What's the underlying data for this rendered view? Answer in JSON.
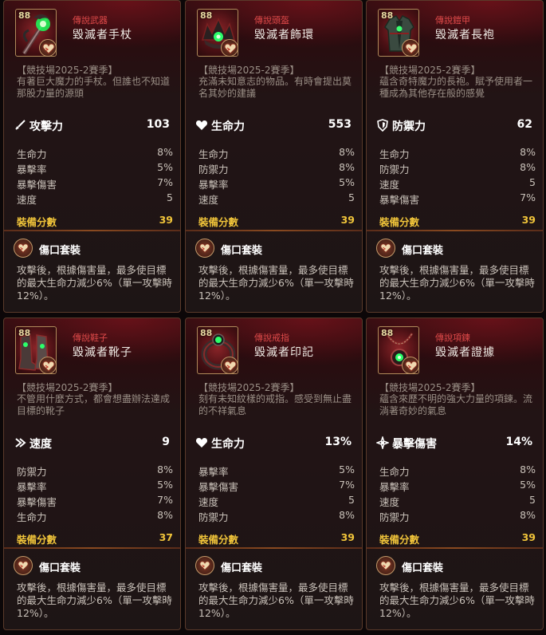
{
  "cards": [
    {
      "level": "88",
      "rarity": "傳說武器",
      "name": "毀滅者手杖",
      "season": "【競技場2025-2賽季】",
      "description": "有著巨大魔力的手杖。但誰也不知道那股力量的源頭",
      "main_stat": {
        "icon": "sword-icon",
        "label": "攻擊力",
        "value": "103"
      },
      "sub_stats": [
        {
          "label": "生命力",
          "value": "8%"
        },
        {
          "label": "暴擊率",
          "value": "5%"
        },
        {
          "label": "暴擊傷害",
          "value": "7%"
        },
        {
          "label": "速度",
          "value": "5"
        }
      ],
      "score_label": "裝備分數",
      "score": "39",
      "set_name": "傷口套裝",
      "set_desc": "攻擊後，根據傷害量，最多使目標的最大生命力減少6%（單一攻擊時12%）。"
    },
    {
      "level": "88",
      "rarity": "傳說頭盔",
      "name": "毀滅者飾環",
      "season": "【競技場2025-2賽季】",
      "description": "充滿未知意志的物品。有時會提出莫名其妙的建議",
      "main_stat": {
        "icon": "heart-icon",
        "label": "生命力",
        "value": "553"
      },
      "sub_stats": [
        {
          "label": "生命力",
          "value": "8%"
        },
        {
          "label": "防禦力",
          "value": "8%"
        },
        {
          "label": "暴擊率",
          "value": "5%"
        },
        {
          "label": "速度",
          "value": "5"
        }
      ],
      "score_label": "裝備分數",
      "score": "39",
      "set_name": "傷口套裝",
      "set_desc": "攻擊後，根據傷害量，最多使目標的最大生命力減少6%（單一攻擊時12%）。"
    },
    {
      "level": "88",
      "rarity": "傳說鎧甲",
      "name": "毀滅者長袍",
      "season": "【競技場2025-2賽季】",
      "description": "蘊含奇特魔力的長袍。賦予使用者一種成為其他存在般的感覺",
      "main_stat": {
        "icon": "shield-icon",
        "label": "防禦力",
        "value": "62"
      },
      "sub_stats": [
        {
          "label": "生命力",
          "value": "8%"
        },
        {
          "label": "防禦力",
          "value": "8%"
        },
        {
          "label": "速度",
          "value": "5"
        },
        {
          "label": "暴擊傷害",
          "value": "7%"
        }
      ],
      "score_label": "裝備分數",
      "score": "39",
      "set_name": "傷口套裝",
      "set_desc": "攻擊後，根據傷害量，最多使目標的最大生命力減少6%（單一攻擊時12%）。"
    },
    {
      "level": "88",
      "rarity": "傳說鞋子",
      "name": "毀滅者靴子",
      "season": "【競技場2025-2賽季】",
      "description": "不管用什麼方式，都會想盡辦法達成目標的靴子",
      "main_stat": {
        "icon": "speed-icon",
        "label": "速度",
        "value": "9"
      },
      "sub_stats": [
        {
          "label": "防禦力",
          "value": "8%"
        },
        {
          "label": "暴擊率",
          "value": "5%"
        },
        {
          "label": "暴擊傷害",
          "value": "7%"
        },
        {
          "label": "生命力",
          "value": "8%"
        }
      ],
      "score_label": "裝備分數",
      "score": "37",
      "set_name": "傷口套裝",
      "set_desc": "攻擊後，根據傷害量，最多使目標的最大生命力減少6%（單一攻擊時12%）。"
    },
    {
      "level": "88",
      "rarity": "傳說戒指",
      "name": "毀滅者印記",
      "season": "【競技場2025-2賽季】",
      "description": "刻有未知紋樣的戒指。感受到無止盡的不祥氣息",
      "main_stat": {
        "icon": "heart-icon",
        "label": "生命力",
        "value": "13%"
      },
      "sub_stats": [
        {
          "label": "暴擊率",
          "value": "5%"
        },
        {
          "label": "暴擊傷害",
          "value": "7%"
        },
        {
          "label": "速度",
          "value": "5"
        },
        {
          "label": "防禦力",
          "value": "8%"
        }
      ],
      "score_label": "裝備分數",
      "score": "39",
      "set_name": "傷口套裝",
      "set_desc": "攻擊後，根據傷害量，最多使目標的最大生命力減少6%（單一攻擊時12%）。"
    },
    {
      "level": "88",
      "rarity": "傳說項鍊",
      "name": "毀滅者證據",
      "season": "【競技場2025-2賽季】",
      "description": "蘊含來歷不明的強大力量的項鍊。流淌著奇妙的氣息",
      "main_stat": {
        "icon": "crit-damage-icon",
        "label": "暴擊傷害",
        "value": "14%"
      },
      "sub_stats": [
        {
          "label": "生命力",
          "value": "8%"
        },
        {
          "label": "暴擊率",
          "value": "5%"
        },
        {
          "label": "速度",
          "value": "5"
        },
        {
          "label": "防禦力",
          "value": "8%"
        }
      ],
      "score_label": "裝備分數",
      "score": "39",
      "set_name": "傷口套裝",
      "set_desc": "攻擊後，根據傷害量，最多使目標的最大生命力減少6%（單一攻擊時12%）。"
    }
  ]
}
